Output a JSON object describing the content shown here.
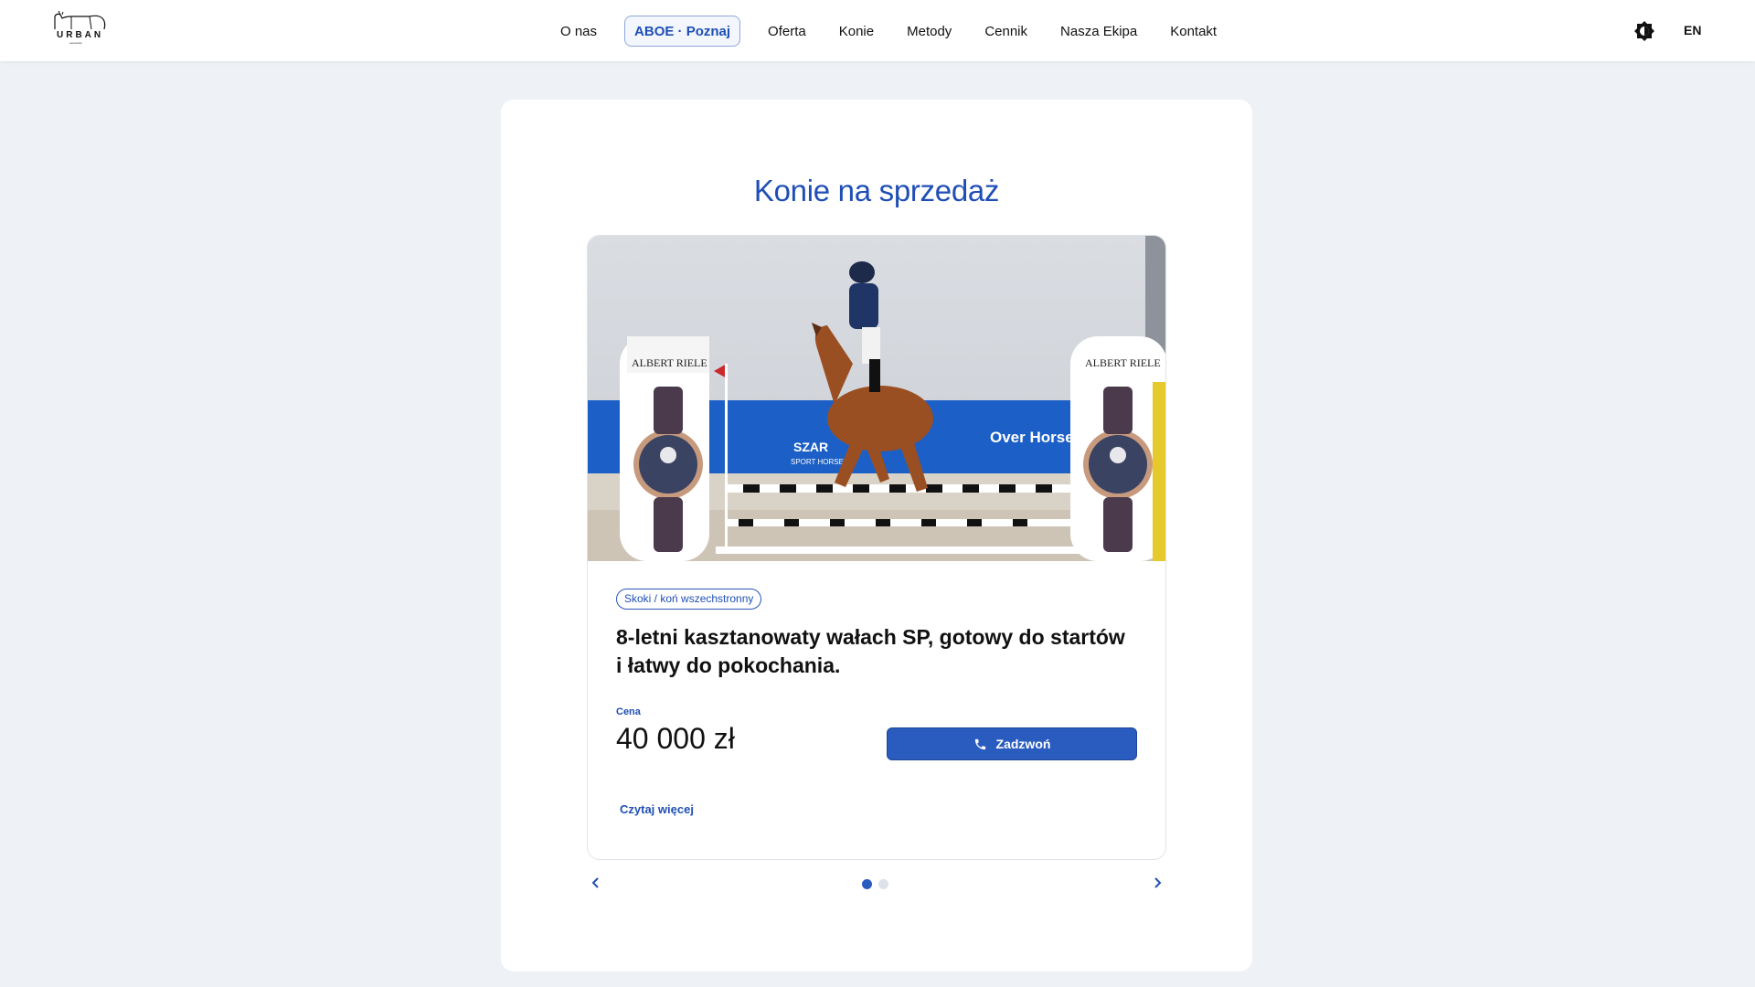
{
  "header": {
    "logo_text": "URBAN",
    "logo_sub": "equestrian",
    "nav": [
      {
        "label": "O nas",
        "active": false
      },
      {
        "label": "ABOE · Poznaj",
        "active": true
      },
      {
        "label": "Oferta",
        "active": false
      },
      {
        "label": "Konie",
        "active": false
      },
      {
        "label": "Metody",
        "active": false
      },
      {
        "label": "Cennik",
        "active": false
      },
      {
        "label": "Nasza Ekipa",
        "active": false
      },
      {
        "label": "Kontakt",
        "active": false
      }
    ],
    "language": "EN",
    "theme_icon": "theme-toggle-icon"
  },
  "section": {
    "title": "Konie na sprzedaż"
  },
  "listing": {
    "photo_icon": "horse-jumping-photo",
    "photo_text": {
      "sponsor_left": "ALBERT RIELE",
      "sponsor_right": "ALBERT RIELE",
      "banner_brand": "Over Horse",
      "banner_brand2": "SZAR",
      "banner_brand2_sub": "SPORT HORSE"
    },
    "tag": "Skoki / koń wszechstronny",
    "title": "8-letni kasztanowaty wałach SP, gotowy do startów i łatwy do pokochania.",
    "price_label": "Cena",
    "price_value": "40 000 zł",
    "call_label": "Zadzwoń",
    "read_more": "Czytaj więcej"
  },
  "carousel": {
    "slides": 2,
    "active_index": 0
  },
  "colors": {
    "accent": "#1f4fb5",
    "button": "#2a5cbf",
    "background": "#eef1f6"
  }
}
